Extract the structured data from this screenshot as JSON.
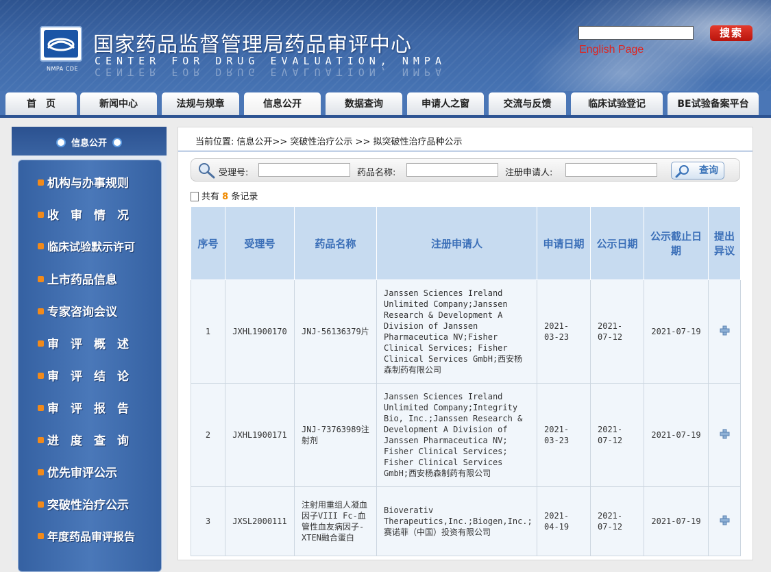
{
  "header": {
    "logo_caption": "NMPA CDE",
    "title_cn": "国家药品监督管理局药品审评中心",
    "title_en": "CENTER FOR DRUG EVALUATION, NMPA",
    "search_button": "搜索",
    "search_value": "",
    "english_link": "English Page"
  },
  "nav": {
    "tabs": [
      "首　页",
      "新闻中心",
      "法规与规章",
      "信息公开",
      "数据查询",
      "申请人之窗",
      "交流与反馈",
      "临床试验登记",
      "BE试验备案平台"
    ],
    "active": "信息公开"
  },
  "sidebar": {
    "title": "信息公开",
    "items": [
      "机构与办事规则",
      "收　审　情　况",
      "临床试验默示许可",
      "上市药品信息",
      "专家咨询会议",
      "审　评　概　述",
      "审　评　结　论",
      "审　评　报　告",
      "进　度　查　询",
      "优先审评公示",
      "突破性治疗公示",
      "年度药品审评报告"
    ]
  },
  "main": {
    "breadcrumb": "当前位置:  信息公开>> 突破性治疗公示 >> 拟突破性治疗品种公示",
    "query": {
      "label_acceptance": "受理号:",
      "label_drug": "药品名称:",
      "label_applicant": "注册申请人:",
      "value_acceptance": "",
      "value_drug": "",
      "value_applicant": "",
      "button": "查询"
    },
    "records_prefix": "共有",
    "records_count": "8",
    "records_suffix": "条记录",
    "columns": [
      "序号",
      "受理号",
      "药品名称",
      "注册申请人",
      "申请日期",
      "公示日期",
      "公示截止日期",
      "提出异议"
    ],
    "rows": [
      {
        "no": "1",
        "acceptance": "JXHL1900170",
        "drug": "JNJ-56136379片",
        "applicant": "Janssen Sciences Ireland Unlimited Company;Janssen Research & Development A Division of Janssen Pharmaceutica NV;Fisher Clinical Services; Fisher Clinical Services GmbH;西安杨森制药有限公司",
        "apply_date": "2021-03-23",
        "publish_date": "2021-07-12",
        "deadline": "2021-07-19"
      },
      {
        "no": "2",
        "acceptance": "JXHL1900171",
        "drug": "JNJ-73763989注射剂",
        "applicant": "Janssen Sciences Ireland Unlimited Company;Integrity Bio, Inc.;Janssen Research & Development A Division of Janssen Pharmaceutica NV; Fisher Clinical Services; Fisher Clinical Services GmbH;西安杨森制药有限公司",
        "apply_date": "2021-03-23",
        "publish_date": "2021-07-12",
        "deadline": "2021-07-19"
      },
      {
        "no": "3",
        "acceptance": "JXSL2000111",
        "drug": "注射用重组人凝血因子VIII Fc-血管性血友病因子-XTEN融合蛋白",
        "applicant": "Bioverativ Therapeutics,Inc.;Biogen,Inc.;赛诺菲（中国）投资有限公司",
        "apply_date": "2021-04-19",
        "publish_date": "2021-07-12",
        "deadline": "2021-07-19"
      }
    ]
  },
  "icons": {
    "logo": "cde-logo-icon",
    "query": "magnifier-icon",
    "objection": "plus-icon",
    "sidebar_bullet": "rss-icon"
  },
  "colors": {
    "header_blue": "#3d67a6",
    "search_red": "#d0281c",
    "english_link_red": "#e0231d",
    "table_header_bg": "#c7dbf0",
    "table_header_text": "#3b6fb8",
    "record_count_orange": "#f08a00"
  }
}
